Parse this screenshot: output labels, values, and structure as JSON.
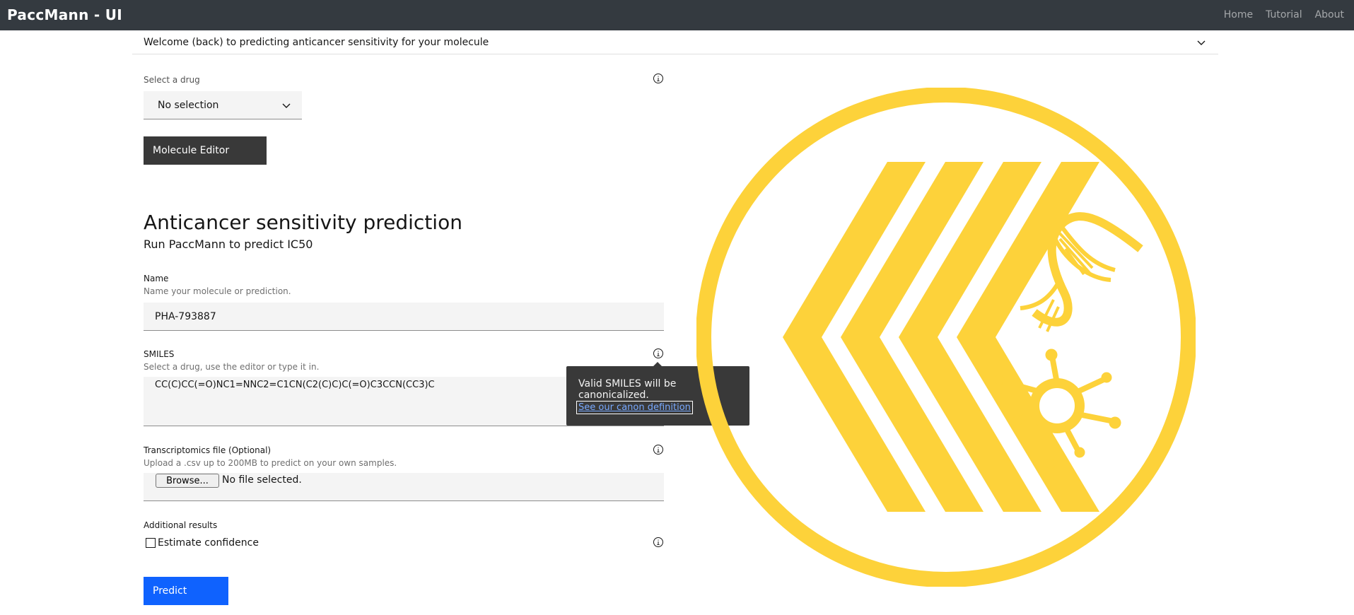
{
  "header": {
    "brand": "PaccMann - UI",
    "nav": [
      "Home",
      "Tutorial",
      "About"
    ]
  },
  "accordion": {
    "title": "Welcome (back) to predicting anticancer sensitivity for your molecule"
  },
  "drug_select": {
    "label": "Select a drug",
    "value": "No selection"
  },
  "molecule_editor_button": "Molecule Editor",
  "section": {
    "title": "Anticancer sensitivity prediction",
    "subtitle": "Run PaccMann to predict IC50"
  },
  "name_field": {
    "label": "Name",
    "helper": "Name your molecule or prediction.",
    "value": "PHA-793887"
  },
  "smiles_field": {
    "label": "SMILES",
    "helper": "Select a drug, use the editor or type it in.",
    "value": "CC(C)CC(=O)NC1=NNC2=C1CN(C2(C)C)C(=O)C3CCN(CC3)C"
  },
  "tooltip": {
    "text": "Valid SMILES will be canonicalized.",
    "link": "See our canon definition"
  },
  "transcriptomics_field": {
    "label": "Transcriptomics file (Optional)",
    "helper": "Upload a .csv up to 200MB to predict on your own samples.",
    "browse_label": "Browse...",
    "status": "No file selected."
  },
  "additional_results": {
    "label": "Additional results",
    "checkbox_label": "Estimate confidence",
    "checked": false
  },
  "predict_button": "Predict",
  "colors": {
    "topbar": "#343a40",
    "logo_yellow": "#fdd23a",
    "primary": "#0f62fe",
    "tooltip_bg": "#393939"
  }
}
